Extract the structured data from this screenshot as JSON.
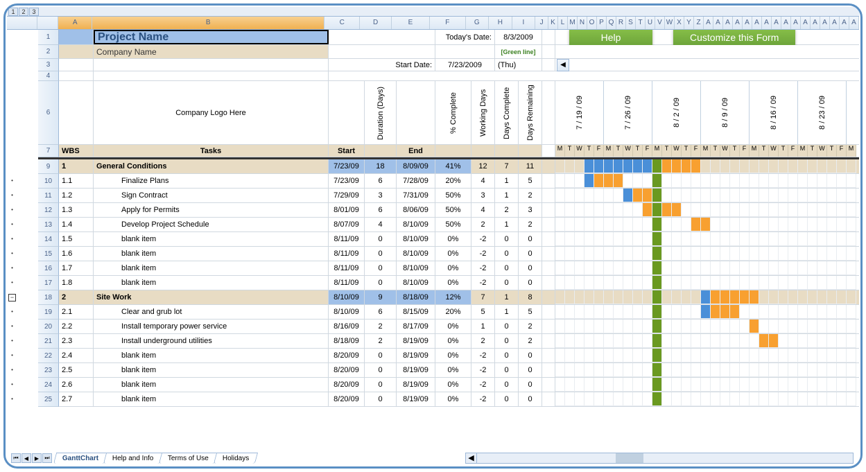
{
  "outline_levels": [
    "1",
    "2",
    "3"
  ],
  "columns": [
    "A",
    "B",
    "C",
    "D",
    "E",
    "F",
    "G",
    "H",
    "I",
    "J",
    "K",
    "L",
    "M",
    "N",
    "O",
    "P",
    "Q",
    "R",
    "S",
    "T",
    "U",
    "V",
    "W",
    "X",
    "Y",
    "Z",
    "A",
    "A",
    "A",
    "A",
    "A",
    "A",
    "A",
    "A",
    "A",
    "A",
    "A",
    "A",
    "A",
    "A",
    "A",
    "A"
  ],
  "header": {
    "project_name": "Project Name",
    "company_name": "Company Name",
    "todays_date_label": "Today's Date:",
    "todays_date": "8/3/2009",
    "green_line": "[Green line]",
    "start_date_label": "Start Date:",
    "start_date": "7/23/2009",
    "start_day": "(Thu)",
    "help_btn": "Help",
    "customize_btn": "Customize this Form",
    "logo_text": "Company Logo Here"
  },
  "task_headers": {
    "wbs": "WBS",
    "tasks": "Tasks",
    "start": "Start",
    "duration": "Duration (Days)",
    "end": "End",
    "pct": "% Complete",
    "wd": "Working Days",
    "dc": "Days Complete",
    "dr": "Days Remaining"
  },
  "weeks": [
    "7 / 19 / 09",
    "7 / 26 / 09",
    "8 / 2 / 09",
    "8 / 9 / 09",
    "8 / 16 / 09",
    "8 / 23 / 09"
  ],
  "day_letters": [
    "M",
    "T",
    "W",
    "T",
    "F",
    "M",
    "T",
    "W",
    "T",
    "F",
    "M",
    "T",
    "W",
    "T",
    "F",
    "M",
    "T",
    "W",
    "T",
    "F",
    "M",
    "T",
    "W",
    "T",
    "F",
    "M",
    "T",
    "W",
    "T",
    "F",
    "M"
  ],
  "tasks": [
    {
      "row": 9,
      "wbs": "1",
      "name": "General Conditions",
      "start": "7/23/09",
      "dur": "18",
      "end": "8/09/09",
      "pct": "41%",
      "wd": "12",
      "dc": "7",
      "dr": "11",
      "bold": true,
      "tan": true,
      "blue": true,
      "gstart": 3,
      "blue_len": 7,
      "orange_len": 5
    },
    {
      "row": 10,
      "wbs": "1.1",
      "name": "Finalize Plans",
      "start": "7/23/09",
      "dur": "6",
      "end": "7/28/09",
      "pct": "20%",
      "wd": "4",
      "dc": "1",
      "dr": "5",
      "gstart": 3,
      "blue_len": 1,
      "orange_len": 3
    },
    {
      "row": 11,
      "wbs": "1.2",
      "name": "Sign Contract",
      "start": "7/29/09",
      "dur": "3",
      "end": "7/31/09",
      "pct": "50%",
      "wd": "3",
      "dc": "1",
      "dr": "2",
      "gstart": 7,
      "blue_len": 1,
      "orange_len": 2
    },
    {
      "row": 12,
      "wbs": "1.3",
      "name": "Apply for Permits",
      "start": "8/01/09",
      "dur": "6",
      "end": "8/06/09",
      "pct": "50%",
      "wd": "4",
      "dc": "2",
      "dr": "3",
      "gstart": 9,
      "blue_len": 0,
      "orange_len": 4
    },
    {
      "row": 13,
      "wbs": "1.4",
      "name": "Develop Project Schedule",
      "start": "8/07/09",
      "dur": "4",
      "end": "8/10/09",
      "pct": "50%",
      "wd": "2",
      "dc": "1",
      "dr": "2",
      "gstart": 14,
      "blue_len": 0,
      "orange_len": 2
    },
    {
      "row": 14,
      "wbs": "1.5",
      "name": "blank item",
      "start": "8/11/09",
      "dur": "0",
      "end": "8/10/09",
      "pct": "0%",
      "wd": "-2",
      "dc": "0",
      "dr": "0"
    },
    {
      "row": 15,
      "wbs": "1.6",
      "name": "blank item",
      "start": "8/11/09",
      "dur": "0",
      "end": "8/10/09",
      "pct": "0%",
      "wd": "-2",
      "dc": "0",
      "dr": "0"
    },
    {
      "row": 16,
      "wbs": "1.7",
      "name": "blank item",
      "start": "8/11/09",
      "dur": "0",
      "end": "8/10/09",
      "pct": "0%",
      "wd": "-2",
      "dc": "0",
      "dr": "0"
    },
    {
      "row": 17,
      "wbs": "1.8",
      "name": "blank item",
      "start": "8/11/09",
      "dur": "0",
      "end": "8/10/09",
      "pct": "0%",
      "wd": "-2",
      "dc": "0",
      "dr": "0"
    },
    {
      "row": 18,
      "wbs": "2",
      "name": "Site Work",
      "start": "8/10/09",
      "dur": "9",
      "end": "8/18/09",
      "pct": "12%",
      "wd": "7",
      "dc": "1",
      "dr": "8",
      "bold": true,
      "tan": true,
      "blue": true,
      "gstart": 15,
      "blue_len": 1,
      "orange_len": 5,
      "minus": true
    },
    {
      "row": 19,
      "wbs": "2.1",
      "name": "Clear and grub lot",
      "start": "8/10/09",
      "dur": "6",
      "end": "8/15/09",
      "pct": "20%",
      "wd": "5",
      "dc": "1",
      "dr": "5",
      "gstart": 15,
      "blue_len": 1,
      "orange_len": 3
    },
    {
      "row": 20,
      "wbs": "2.2",
      "name": "Install temporary power service",
      "start": "8/16/09",
      "dur": "2",
      "end": "8/17/09",
      "pct": "0%",
      "wd": "1",
      "dc": "0",
      "dr": "2",
      "gstart": 20,
      "blue_len": 0,
      "orange_len": 1
    },
    {
      "row": 21,
      "wbs": "2.3",
      "name": "Install underground utilities",
      "start": "8/18/09",
      "dur": "2",
      "end": "8/19/09",
      "pct": "0%",
      "wd": "2",
      "dc": "0",
      "dr": "2",
      "gstart": 21,
      "blue_len": 0,
      "orange_len": 2
    },
    {
      "row": 22,
      "wbs": "2.4",
      "name": "blank item",
      "start": "8/20/09",
      "dur": "0",
      "end": "8/19/09",
      "pct": "0%",
      "wd": "-2",
      "dc": "0",
      "dr": "0"
    },
    {
      "row": 23,
      "wbs": "2.5",
      "name": "blank item",
      "start": "8/20/09",
      "dur": "0",
      "end": "8/19/09",
      "pct": "0%",
      "wd": "-2",
      "dc": "0",
      "dr": "0"
    },
    {
      "row": 24,
      "wbs": "2.6",
      "name": "blank item",
      "start": "8/20/09",
      "dur": "0",
      "end": "8/19/09",
      "pct": "0%",
      "wd": "-2",
      "dc": "0",
      "dr": "0"
    },
    {
      "row": 25,
      "wbs": "2.7",
      "name": "blank item",
      "start": "8/20/09",
      "dur": "0",
      "end": "8/19/09",
      "pct": "0%",
      "wd": "-2",
      "dc": "0",
      "dr": "0"
    }
  ],
  "sheet_tabs": [
    "GanttChart",
    "Help and Info",
    "Terms of Use",
    "Holidays"
  ],
  "today_col": 10
}
